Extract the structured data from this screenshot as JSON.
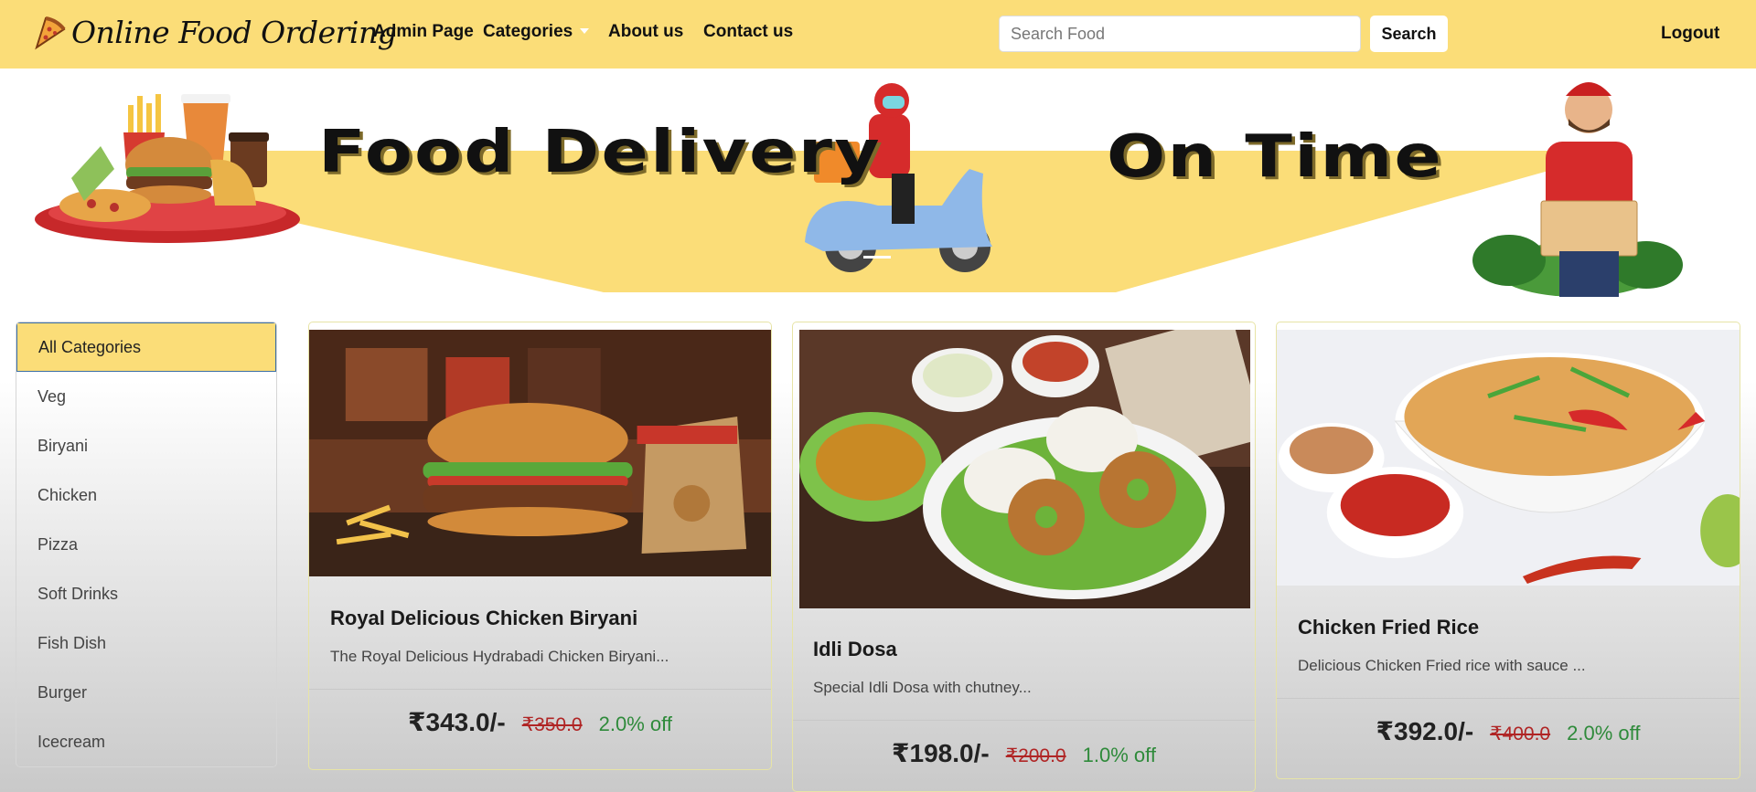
{
  "header": {
    "brand": "Online Food Ordering",
    "nav": {
      "admin": "Admin Page",
      "categories": "Categories",
      "about": "About us",
      "contact": "Contact us"
    },
    "search": {
      "placeholder": "Search Food",
      "button": "Search"
    },
    "logout": "Logout"
  },
  "banner": {
    "headline_left": "Food Delivery",
    "headline_right": "On Time",
    "colors": {
      "ribbon": "#fbdd78"
    }
  },
  "sidebar": {
    "items": [
      {
        "label": "All Categories"
      },
      {
        "label": "Veg"
      },
      {
        "label": "Biryani"
      },
      {
        "label": "Chicken"
      },
      {
        "label": "Pizza"
      },
      {
        "label": "Soft Drinks"
      },
      {
        "label": "Fish Dish"
      },
      {
        "label": "Burger"
      },
      {
        "label": "Icecream"
      }
    ]
  },
  "products": [
    {
      "title": "Royal Delicious Chicken Biryani",
      "description": "The Royal Delicious Hydrabadi Chicken Biryani...",
      "price": "₹343.0/-",
      "old_price": "₹350.0",
      "discount": "2.0% off"
    },
    {
      "title": "Idli Dosa",
      "description": "Special Idli Dosa with chutney...",
      "price": "₹198.0/-",
      "old_price": "₹200.0",
      "discount": "1.0% off"
    },
    {
      "title": "Chicken Fried Rice",
      "description": "Delicious Chicken Fried rice with sauce ...",
      "price": "₹392.0/-",
      "old_price": "₹400.0",
      "discount": "2.0% off"
    }
  ],
  "theme": {
    "accent": "#fbdd78",
    "price_old": "#b02525",
    "discount": "#2e8a3a"
  }
}
